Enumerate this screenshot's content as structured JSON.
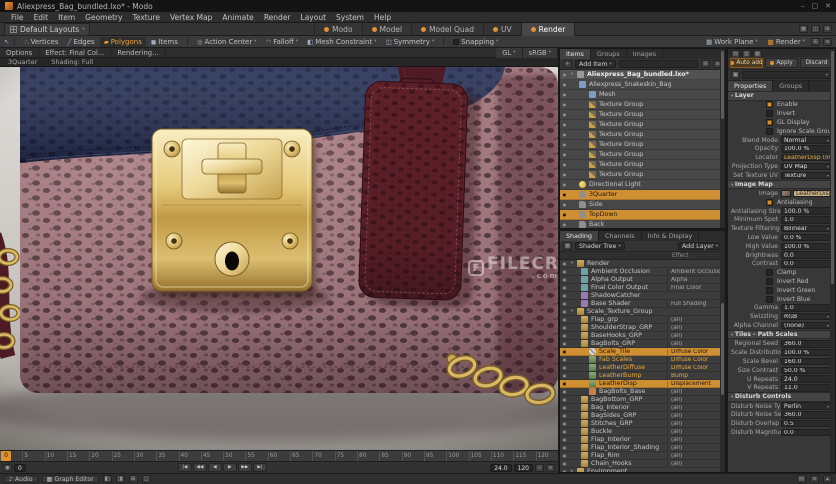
{
  "colors": {
    "accent": "#e0922f",
    "selection": "#cf8f33",
    "panel": "#383838",
    "viewport_bg": "#c9c6c2"
  },
  "window": {
    "title": "Aliexpress_Bag_bundled.lxo* - Modo",
    "minimize": "–",
    "maximize": "▢",
    "close": "✕"
  },
  "menu": [
    {
      "t": "File"
    },
    {
      "t": "Edit"
    },
    {
      "t": "Item"
    },
    {
      "t": "Geometry"
    },
    {
      "t": "Texture"
    },
    {
      "t": "Vertex Map"
    },
    {
      "t": "Animate"
    },
    {
      "t": "Render"
    },
    {
      "t": "Layout"
    },
    {
      "t": "System"
    },
    {
      "t": "Help"
    }
  ],
  "layoutbar": {
    "layouts_label": "Default Layouts",
    "tabs": [
      {
        "label": "Modo"
      },
      {
        "label": "Model"
      },
      {
        "label": "Model Quad"
      },
      {
        "label": "UV"
      },
      {
        "label": "Render",
        "state": "active"
      }
    ]
  },
  "toolbar": {
    "cursor_glyph": "↖",
    "modes": [
      {
        "glyph": "∴",
        "label": "Vertices"
      },
      {
        "glyph": "╱",
        "label": "Edges"
      },
      {
        "glyph": "▰",
        "label": "Polygons",
        "state": "active"
      },
      {
        "glyph": "◼",
        "label": "Items"
      }
    ],
    "dropdowns": [
      {
        "glyph": "◎",
        "label": "Action Center"
      },
      {
        "glyph": "◠",
        "label": "Falloff"
      },
      {
        "glyph": "◧",
        "label": "Mesh Constraint"
      },
      {
        "glyph": "◫",
        "label": "Symmetry"
      }
    ],
    "snapping_label": "Snapping",
    "workplane_label": "Work Plane",
    "render_label": "Render"
  },
  "vp_header": {
    "options": "Options",
    "effect": "Effect: Final Col...",
    "rendering": "Rendering...",
    "gl": "GL",
    "srgb": "sRGB",
    "camera": "3Quarter",
    "shading": "Shading: Full"
  },
  "watermark": {
    "logo": "F",
    "text": "FILECR",
    "suffix": ".com"
  },
  "items_panel": {
    "tabs": [
      {
        "label": "Items",
        "state": "active"
      },
      {
        "label": "Groups"
      },
      {
        "label": "Images"
      }
    ],
    "add_label": "Add Item",
    "rows": [
      {
        "pad": 2,
        "arrow": "▾",
        "icon": "ic-scene",
        "label": "Aliexpress_Bag_bundled.lxo*",
        "state": "root"
      },
      {
        "pad": 10,
        "arrow": "▾",
        "icon": "ic-mesh",
        "label": "Aliexpress_Snakeskin_Bag"
      },
      {
        "pad": 20,
        "arrow": "",
        "icon": "ic-mesh",
        "label": "Mesh"
      },
      {
        "pad": 20,
        "arrow": "▸",
        "icon": "ic-txgrp",
        "label": "Texture Group"
      },
      {
        "pad": 20,
        "arrow": "▸",
        "icon": "ic-txgrp",
        "label": "Texture Group"
      },
      {
        "pad": 20,
        "arrow": "▸",
        "icon": "ic-txgrp",
        "label": "Texture Group"
      },
      {
        "pad": 20,
        "arrow": "▸",
        "icon": "ic-txgrp",
        "label": "Texture Group"
      },
      {
        "pad": 20,
        "arrow": "▸",
        "icon": "ic-txgrp",
        "label": "Texture Group"
      },
      {
        "pad": 20,
        "arrow": "▸",
        "icon": "ic-txgrp",
        "label": "Texture Group"
      },
      {
        "pad": 20,
        "arrow": "▸",
        "icon": "ic-txgrp",
        "label": "Texture Group"
      },
      {
        "pad": 20,
        "arrow": "▸",
        "icon": "ic-txgrp",
        "label": "Texture Group"
      },
      {
        "pad": 10,
        "arrow": "",
        "icon": "ic-light",
        "label": "Directional Light"
      },
      {
        "pad": 10,
        "arrow": "",
        "icon": "ic-camera",
        "label": "3Quarter",
        "state": "sel"
      },
      {
        "pad": 10,
        "arrow": "",
        "icon": "ic-camera",
        "label": "Side"
      },
      {
        "pad": 10,
        "arrow": "",
        "icon": "ic-camera",
        "label": "TopDown",
        "state": "sel"
      },
      {
        "pad": 10,
        "arrow": "",
        "icon": "ic-camera",
        "label": "Back"
      }
    ]
  },
  "shading_panel": {
    "tabs": [
      {
        "label": "Shading",
        "state": "active"
      },
      {
        "label": "Channels"
      },
      {
        "label": "Info & Display"
      }
    ],
    "tree_label": "Shader Tree",
    "add_label": "Add Layer",
    "effect_header": "Effect",
    "rows": [
      {
        "pad": 2,
        "arrow": "▾",
        "icon": "ic-folder",
        "label": "Render",
        "effect": ""
      },
      {
        "pad": 12,
        "arrow": "",
        "icon": "ic-out",
        "label": "Ambient Occlusion",
        "effect": "Ambient Occlusion"
      },
      {
        "pad": 12,
        "arrow": "",
        "icon": "ic-out",
        "label": "Alpha Output",
        "effect": "Alpha"
      },
      {
        "pad": 12,
        "arrow": "",
        "icon": "ic-out",
        "label": "Final Color Output",
        "effect": "Final Color"
      },
      {
        "pad": 12,
        "arrow": "",
        "icon": "ic-shader",
        "label": "ShadowCatcher",
        "effect": ""
      },
      {
        "pad": 12,
        "arrow": "",
        "icon": "ic-shader",
        "label": "Base Shader",
        "effect": "Full Shading"
      },
      {
        "pad": 2,
        "arrow": "▾",
        "icon": "ic-folder",
        "label": "Scale_Texture_Group",
        "effect": ""
      },
      {
        "pad": 12,
        "arrow": "▸",
        "icon": "ic-folder",
        "label": "Flap_grp",
        "effect": "(all)"
      },
      {
        "pad": 12,
        "arrow": "▸",
        "icon": "ic-folder",
        "label": "ShoulderStrap_GRP",
        "effect": "(all)"
      },
      {
        "pad": 12,
        "arrow": "▸",
        "icon": "ic-folder",
        "label": "BaseHooks_GRP",
        "effect": "(all)"
      },
      {
        "pad": 12,
        "arrow": "▾",
        "icon": "ic-folder",
        "label": "BagBolts_GRP",
        "effect": "(all)"
      },
      {
        "pad": 20,
        "arrow": "",
        "icon": "ic-checker",
        "label": "Scale_Tile",
        "effect": "Diffuse Color",
        "state": "sel"
      },
      {
        "pad": 20,
        "arrow": "",
        "icon": "ic-img",
        "label": "Fab Scales",
        "effect": "Diffuse Color",
        "state": "hot",
        "effclass": "eff-hot"
      },
      {
        "pad": 20,
        "arrow": "",
        "icon": "ic-img",
        "label": "LeatherDiffuse",
        "effect": "Diffuse Color",
        "state": "hot",
        "effclass": "eff-hot"
      },
      {
        "pad": 20,
        "arrow": "",
        "icon": "ic-img",
        "label": "LeatherBump",
        "effect": "Bump",
        "state": "hot",
        "effclass": "eff-hot"
      },
      {
        "pad": 20,
        "arrow": "",
        "icon": "ic-img",
        "label": "LeatherDisp",
        "effect": "Displacement",
        "state": "sel"
      },
      {
        "pad": 20,
        "arrow": "",
        "icon": "ic-mat",
        "label": "BagBolts_Base",
        "effect": "(all)"
      },
      {
        "pad": 12,
        "arrow": "▸",
        "icon": "ic-folder",
        "label": "BagBottom_GRP",
        "effect": "(all)"
      },
      {
        "pad": 12,
        "arrow": "▸",
        "icon": "ic-folder",
        "label": "Bag_Interior",
        "effect": "(all)"
      },
      {
        "pad": 12,
        "arrow": "▸",
        "icon": "ic-folder",
        "label": "BagSides_GRP",
        "effect": "(all)"
      },
      {
        "pad": 12,
        "arrow": "▸",
        "icon": "ic-folder",
        "label": "Stitches_GRP",
        "effect": "(all)"
      },
      {
        "pad": 12,
        "arrow": "▸",
        "icon": "ic-folder",
        "label": "Buckle",
        "effect": "(all)"
      },
      {
        "pad": 12,
        "arrow": "▸",
        "icon": "ic-folder",
        "label": "Flap_Interior",
        "effect": "(all)"
      },
      {
        "pad": 12,
        "arrow": "▸",
        "icon": "ic-folder",
        "label": "Flap_Interior_Shading",
        "effect": "(all)"
      },
      {
        "pad": 12,
        "arrow": "▸",
        "icon": "ic-folder",
        "label": "Flap_Rim",
        "effect": "(all)"
      },
      {
        "pad": 12,
        "arrow": "▸",
        "icon": "ic-folder",
        "label": "Chain_Hooks",
        "effect": "(all)"
      },
      {
        "pad": 2,
        "arrow": "▸",
        "icon": "ic-folder",
        "label": "Environment",
        "effect": ""
      }
    ]
  },
  "props_panel": {
    "auto_add": "Auto add",
    "apply": "Apply",
    "discard": "Discard",
    "tabs": [
      {
        "label": "Properties",
        "state": "active"
      },
      {
        "label": "Groups"
      }
    ],
    "rows": [
      {
        "type": "header",
        "label": "Layer"
      },
      {
        "type": "check",
        "label": "Enable",
        "on": "on"
      },
      {
        "type": "check",
        "label": "Invert"
      },
      {
        "type": "check",
        "label": "GL Display",
        "on": "on"
      },
      {
        "type": "check",
        "label": "Ignore Scale Group"
      },
      {
        "type": "drop",
        "label": "Blend Mode",
        "value": "Normal"
      },
      {
        "type": "field",
        "label": "Opacity",
        "value": "100.0 %"
      },
      {
        "type": "drop",
        "label": "Locator",
        "value": "LeatherDisp (Image)",
        "vclass": "v-orange"
      },
      {
        "type": "drop",
        "label": "Projection Type",
        "value": "UV Map"
      },
      {
        "type": "drop",
        "label": "Set Texture UV",
        "value": "Texture"
      },
      {
        "type": "header",
        "label": "Image Map"
      },
      {
        "type": "image",
        "label": "Image",
        "value": "LeatherDisp"
      },
      {
        "type": "check",
        "label": "Antialiasing",
        "on": "on"
      },
      {
        "type": "field",
        "label": "Antialiasing Strength",
        "value": "100.0 %"
      },
      {
        "type": "field",
        "label": "Minimum Spot",
        "value": "1.0"
      },
      {
        "type": "drop",
        "label": "Texture Filtering",
        "value": "Bilinear"
      },
      {
        "type": "field",
        "label": "Low Value",
        "value": "0.0 %"
      },
      {
        "type": "field",
        "label": "High Value",
        "value": "100.0 %"
      },
      {
        "type": "field",
        "label": "Brightness",
        "value": "0.0"
      },
      {
        "type": "field",
        "label": "Contrast",
        "value": "0.0"
      },
      {
        "type": "check",
        "label": "Clamp"
      },
      {
        "type": "check",
        "label": "Invert Red"
      },
      {
        "type": "check",
        "label": "Invert Green"
      },
      {
        "type": "check",
        "label": "Invert Blue"
      },
      {
        "type": "field",
        "label": "Gamma",
        "value": "1.0"
      },
      {
        "type": "drop",
        "label": "Swizzling",
        "value": "RGB"
      },
      {
        "type": "drop",
        "label": "Alpha Channel",
        "value": "(none)"
      },
      {
        "type": "header",
        "label": "Tiles - Path Scales"
      },
      {
        "type": "field",
        "label": "Regional Seed",
        "value": "360.0"
      },
      {
        "type": "field",
        "label": "Scale Distribution",
        "value": "100.0 %"
      },
      {
        "type": "field",
        "label": "Scale Bevel",
        "value": "160.0"
      },
      {
        "type": "field",
        "label": "Size Contrast",
        "value": "50.0 %"
      },
      {
        "type": "field",
        "label": "U Repeats",
        "value": "24.0"
      },
      {
        "type": "field",
        "label": "V Repeats",
        "value": "11.0"
      },
      {
        "type": "header",
        "label": "Disturb Controls"
      },
      {
        "type": "drop",
        "label": "Disturb Noise Type",
        "value": "Perlin"
      },
      {
        "type": "field",
        "label": "Disturb Noise Seed",
        "value": "360.0"
      },
      {
        "type": "field",
        "label": "Disturb Overlap",
        "value": "0.5"
      },
      {
        "type": "field",
        "label": "Disturb Magnitude",
        "value": "0.0"
      }
    ]
  },
  "timeline": {
    "ticks": [
      {
        "t": "0"
      },
      {
        "t": "5"
      },
      {
        "t": "10"
      },
      {
        "t": "15"
      },
      {
        "t": "20"
      },
      {
        "t": "25"
      },
      {
        "t": "30"
      },
      {
        "t": "35"
      },
      {
        "t": "40"
      },
      {
        "t": "45"
      },
      {
        "t": "50"
      },
      {
        "t": "55"
      },
      {
        "t": "60"
      },
      {
        "t": "65"
      },
      {
        "t": "70"
      },
      {
        "t": "75"
      },
      {
        "t": "80"
      },
      {
        "t": "85"
      },
      {
        "t": "90"
      },
      {
        "t": "95"
      },
      {
        "t": "100"
      },
      {
        "t": "105"
      },
      {
        "t": "110"
      },
      {
        "t": "115"
      },
      {
        "t": "120"
      }
    ],
    "current": "0",
    "buttons": [
      {
        "g": "|◀"
      },
      {
        "g": "◀◀"
      },
      {
        "g": "◀"
      },
      {
        "g": "▶"
      },
      {
        "g": "▶▶"
      },
      {
        "g": "▶|"
      }
    ],
    "field_current": "0",
    "field_fps": "24.0",
    "field_end": "120"
  },
  "bottombar": {
    "audio_glyph": "♪",
    "audio": "Audio",
    "graph_glyph": "▦",
    "graph_editor": "Graph Editor",
    "collapse_glyph": "▴"
  }
}
